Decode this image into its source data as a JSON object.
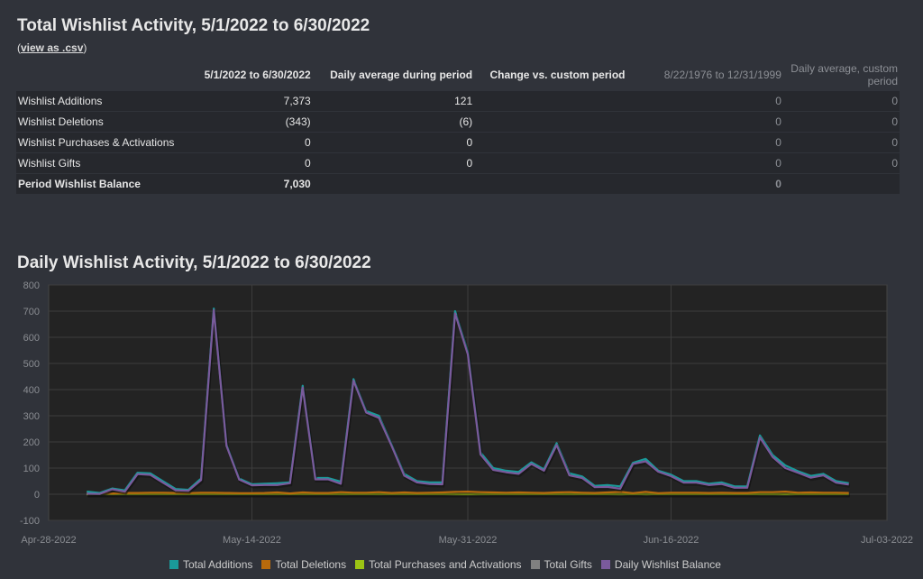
{
  "summary": {
    "title": "Total Wishlist Activity, 5/1/2022 to 6/30/2022",
    "csv_prefix": "(",
    "csv_link": "view as .csv",
    "csv_suffix": ")",
    "columns": [
      "",
      "5/1/2022 to 6/30/2022",
      "Daily average during period",
      "Change vs. custom period",
      "8/22/1976 to 12/31/1999",
      "Daily average, custom period"
    ],
    "rows": [
      {
        "label": "Wishlist Additions",
        "period": "7,373",
        "daily": "121",
        "change": "",
        "custom": "0",
        "custom_daily": "0"
      },
      {
        "label": "Wishlist Deletions",
        "period": "(343)",
        "daily": "(6)",
        "change": "",
        "custom": "0",
        "custom_daily": "0"
      },
      {
        "label": "Wishlist Purchases & Activations",
        "period": "0",
        "daily": "0",
        "change": "",
        "custom": "0",
        "custom_daily": "0"
      },
      {
        "label": "Wishlist Gifts",
        "period": "0",
        "daily": "0",
        "change": "",
        "custom": "0",
        "custom_daily": "0"
      },
      {
        "label": "Period Wishlist Balance",
        "period": "7,030",
        "daily": "",
        "change": "",
        "custom": "0",
        "custom_daily": ""
      }
    ]
  },
  "chart_data": {
    "type": "line",
    "title": "Daily Wishlist Activity, 5/1/2022 to 6/30/2022",
    "x_start": "2022-05-01",
    "x_end": "2022-06-30",
    "xlim": [
      "2022-04-28",
      "2022-07-03"
    ],
    "x_ticks": [
      "Apr-28-2022",
      "May-14-2022",
      "May-31-2022",
      "Jun-16-2022",
      "Jul-03-2022"
    ],
    "ylim": [
      -100,
      800
    ],
    "y_ticks": [
      800,
      700,
      600,
      500,
      400,
      300,
      200,
      100,
      0,
      -100
    ],
    "grid": true,
    "legend_position": "bottom",
    "series": [
      {
        "name": "Total Additions",
        "color": "#1a9a9a",
        "values": [
          10,
          5,
          22,
          15,
          82,
          80,
          50,
          20,
          17,
          60,
          710,
          190,
          60,
          38,
          40,
          42,
          45,
          415,
          62,
          62,
          48,
          440,
          318,
          300,
          190,
          78,
          50,
          45,
          45,
          700,
          545,
          160,
          100,
          90,
          85,
          122,
          95,
          195,
          80,
          68,
          32,
          35,
          30,
          120,
          135,
          90,
          75,
          50,
          50,
          40,
          45,
          30,
          30,
          225,
          150,
          110,
          88,
          70,
          78,
          50,
          42
        ]
      },
      {
        "name": "Total Deletions",
        "color": "#b86a0c",
        "values": [
          8,
          4,
          3,
          5,
          5,
          6,
          6,
          5,
          4,
          6,
          6,
          5,
          4,
          4,
          5,
          7,
          3,
          7,
          5,
          5,
          8,
          6,
          6,
          8,
          5,
          7,
          5,
          6,
          7,
          9,
          10,
          8,
          7,
          6,
          7,
          6,
          5,
          7,
          8,
          6,
          5,
          7,
          9,
          4,
          9,
          4,
          6,
          6,
          6,
          5,
          6,
          5,
          5,
          8,
          8,
          10,
          6,
          7,
          6,
          6,
          5
        ]
      },
      {
        "name": "Total Purchases and Activations",
        "color": "#9cc414",
        "values": [
          0,
          0,
          0,
          0,
          0,
          0,
          0,
          0,
          0,
          0,
          0,
          0,
          0,
          0,
          0,
          0,
          0,
          0,
          0,
          0,
          0,
          0,
          0,
          0,
          0,
          0,
          0,
          0,
          0,
          0,
          0,
          0,
          0,
          0,
          0,
          0,
          0,
          0,
          0,
          0,
          0,
          0,
          0,
          0,
          0,
          0,
          0,
          0,
          0,
          0,
          0,
          0,
          0,
          0,
          0,
          0,
          0,
          0,
          0,
          0,
          0
        ]
      },
      {
        "name": "Total Gifts",
        "color": "#808080",
        "values": [
          0,
          0,
          0,
          0,
          0,
          0,
          0,
          0,
          0,
          0,
          0,
          0,
          0,
          0,
          0,
          0,
          0,
          0,
          0,
          0,
          0,
          0,
          0,
          0,
          0,
          0,
          0,
          0,
          0,
          0,
          0,
          0,
          0,
          0,
          0,
          0,
          0,
          0,
          0,
          0,
          0,
          0,
          0,
          0,
          0,
          0,
          0,
          0,
          0,
          0,
          0,
          0,
          0,
          0,
          0,
          0,
          0,
          0,
          0,
          0,
          0
        ]
      },
      {
        "name": "Daily Wishlist Balance",
        "color": "#7a5a9c",
        "values": [
          2,
          1,
          19,
          10,
          77,
          74,
          44,
          15,
          13,
          54,
          704,
          185,
          56,
          34,
          35,
          35,
          42,
          408,
          57,
          57,
          40,
          434,
          312,
          292,
          185,
          71,
          45,
          39,
          38,
          691,
          535,
          152,
          93,
          84,
          78,
          116,
          90,
          188,
          72,
          62,
          27,
          28,
          21,
          116,
          126,
          86,
          69,
          44,
          44,
          35,
          39,
          25,
          25,
          217,
          142,
          100,
          82,
          63,
          72,
          44,
          37
        ]
      }
    ]
  }
}
